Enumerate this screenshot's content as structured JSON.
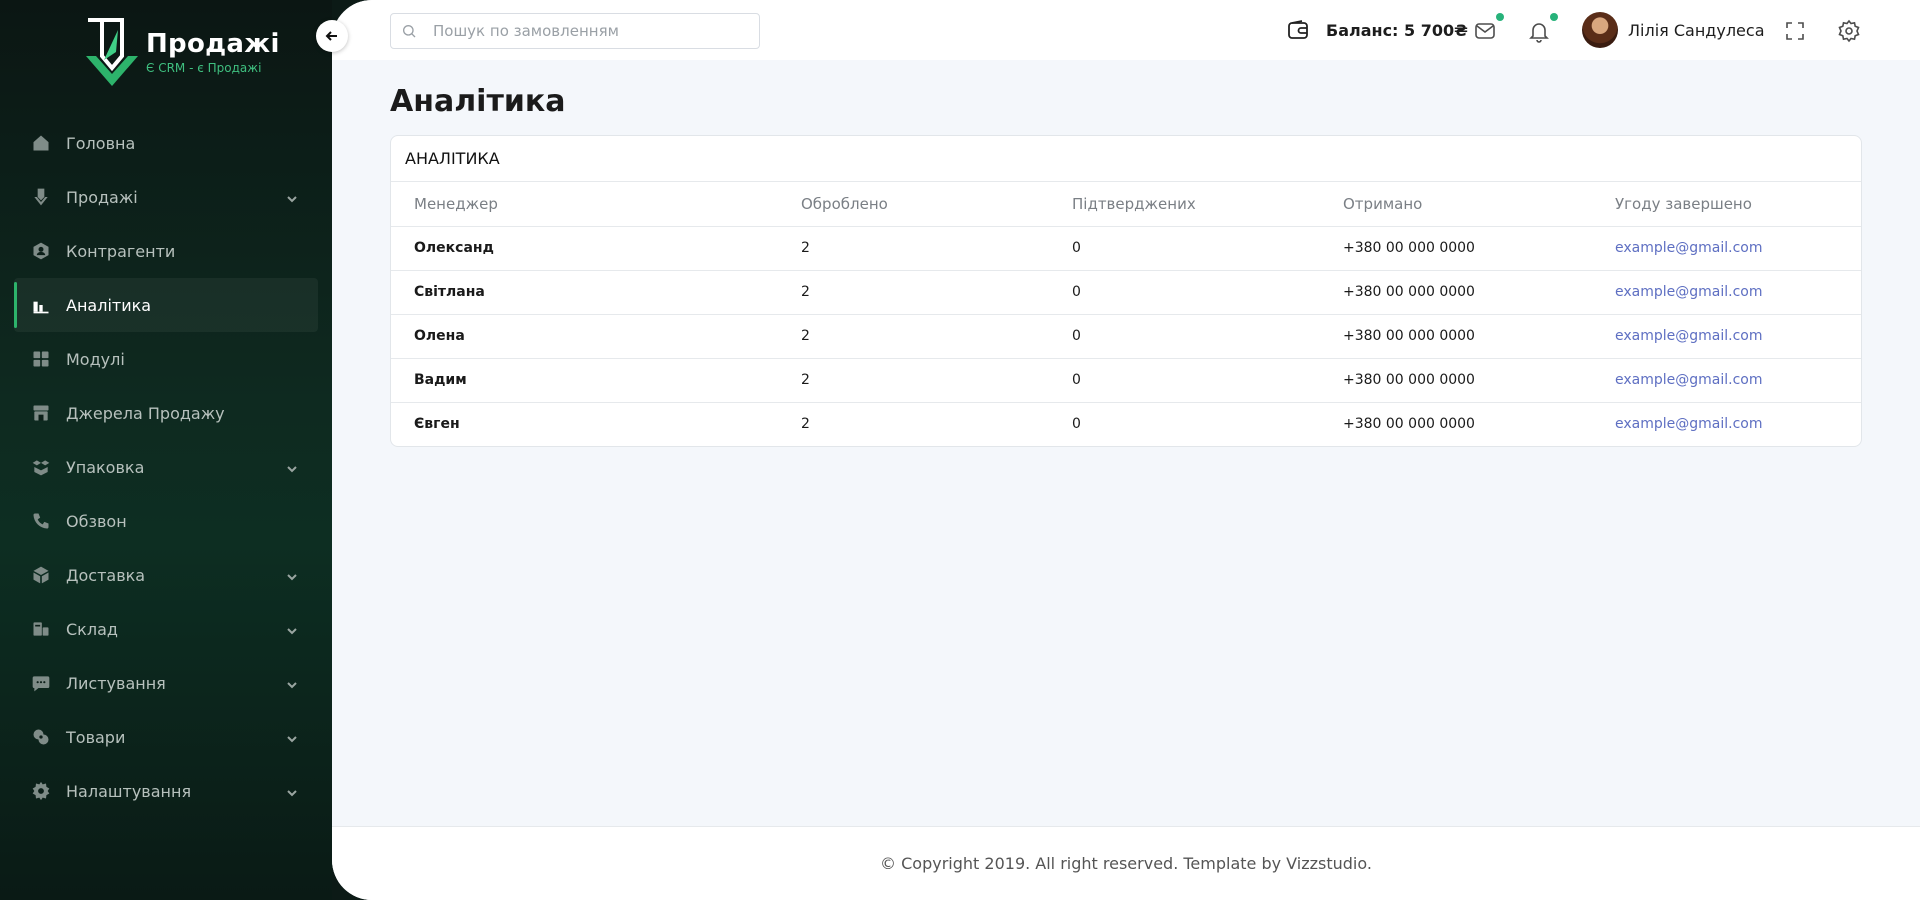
{
  "brand": {
    "title": "Продажі",
    "subtitle": "Є CRM - є Продажі"
  },
  "sidebar": {
    "items": [
      {
        "label": "Головна",
        "icon": "home-icon",
        "expandable": false,
        "active": false
      },
      {
        "label": "Продажі",
        "icon": "sales-icon",
        "expandable": true,
        "active": false
      },
      {
        "label": "Контрагенти",
        "icon": "contacts-icon",
        "expandable": false,
        "active": false
      },
      {
        "label": "Аналітика",
        "icon": "analytics-icon",
        "expandable": false,
        "active": true
      },
      {
        "label": "Модулі",
        "icon": "modules-icon",
        "expandable": false,
        "active": false
      },
      {
        "label": "Джерела Продажу",
        "icon": "store-icon",
        "expandable": false,
        "active": false
      },
      {
        "label": "Упаковка",
        "icon": "package-icon",
        "expandable": true,
        "active": false
      },
      {
        "label": "Обзвон",
        "icon": "phone-icon",
        "expandable": false,
        "active": false
      },
      {
        "label": "Доставка",
        "icon": "delivery-icon",
        "expandable": true,
        "active": false
      },
      {
        "label": "Склад",
        "icon": "warehouse-icon",
        "expandable": true,
        "active": false
      },
      {
        "label": "Листування",
        "icon": "chat-icon",
        "expandable": true,
        "active": false
      },
      {
        "label": "Товари",
        "icon": "products-icon",
        "expandable": true,
        "active": false
      },
      {
        "label": "Налаштування",
        "icon": "settings-icon",
        "expandable": true,
        "active": false
      }
    ]
  },
  "header": {
    "search_placeholder": "Пошук по замовленням",
    "balance": "Баланс: 5 700₴",
    "user_name": "Лілія Сандулеса"
  },
  "page": {
    "title": "Аналітика"
  },
  "table": {
    "title": "АНАЛІТИКА",
    "columns": [
      "Менеджер",
      "Оброблено",
      "Підтверджених",
      "Отримано",
      "Угоду завершено"
    ],
    "rows": [
      [
        "Олександ",
        "2",
        "0",
        "+380 00 000 0000",
        "example@gmail.com"
      ],
      [
        "Світлана",
        "2",
        "0",
        "+380 00 000 0000",
        "example@gmail.com"
      ],
      [
        "Олена",
        "2",
        "0",
        "+380 00 000 0000",
        "example@gmail.com"
      ],
      [
        "Вадим",
        "2",
        "0",
        "+380 00 000 0000",
        "example@gmail.com"
      ],
      [
        "Євген",
        "2",
        "0",
        "+380 00 000 0000",
        "example@gmail.com"
      ]
    ]
  },
  "footer": {
    "text": "© Copyright 2019. All right reserved. Template by Vizzstudio."
  },
  "colors": {
    "accent": "#2db36b",
    "link": "#5e6fc2",
    "sidebar_bg": "#0c1f19",
    "notify_dot": "#27b27a"
  }
}
